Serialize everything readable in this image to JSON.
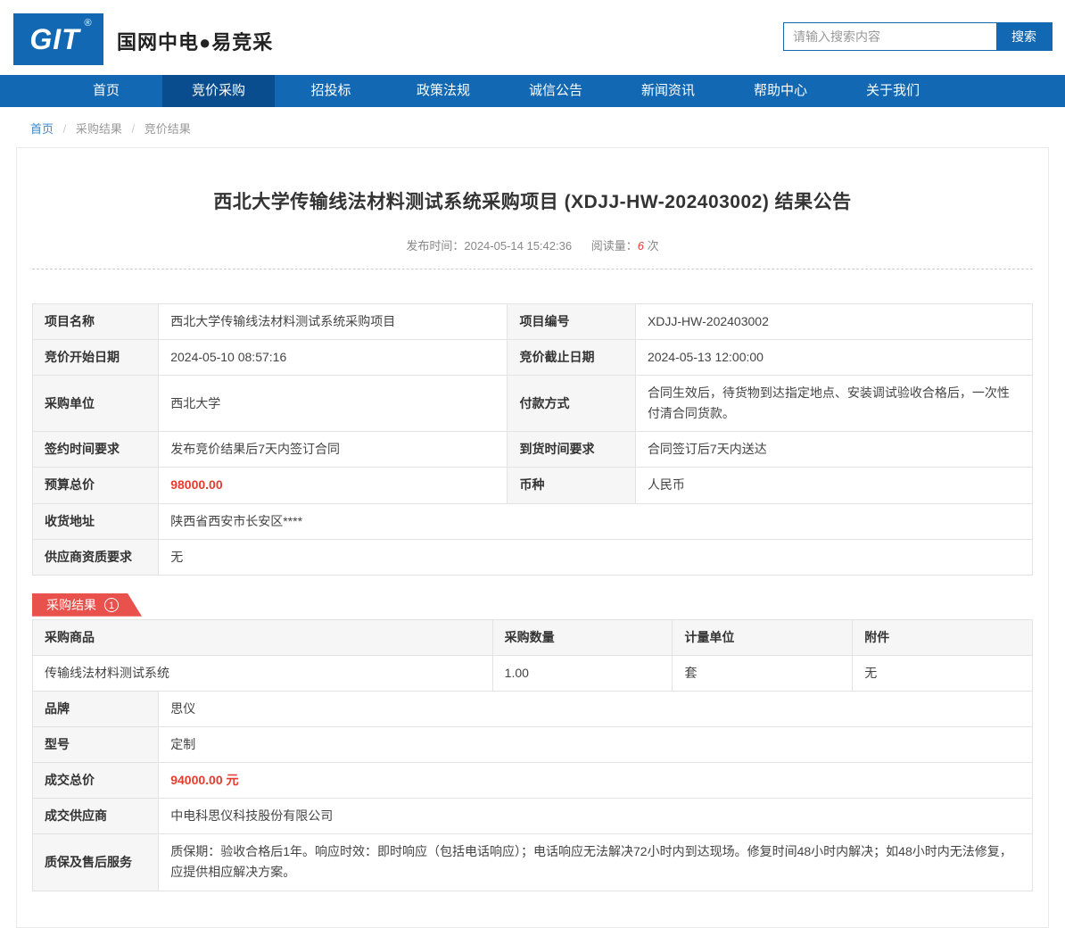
{
  "header": {
    "logo_text": "GIT",
    "logo_reg": "®",
    "brand": "国网中电●易竞采",
    "search": {
      "placeholder": "请输入搜索内容",
      "button_label": "搜索"
    }
  },
  "nav": {
    "items": [
      {
        "label": "首页"
      },
      {
        "label": "竞价采购"
      },
      {
        "label": "招投标"
      },
      {
        "label": "政策法规"
      },
      {
        "label": "诚信公告"
      },
      {
        "label": "新闻资讯"
      },
      {
        "label": "帮助中心"
      },
      {
        "label": "关于我们"
      }
    ],
    "active_index": 1
  },
  "breadcrumb": {
    "items": [
      "首页",
      "采购结果",
      "竞价结果"
    ],
    "separator": "/"
  },
  "article": {
    "title": "西北大学传输线法材料测试系统采购项目 (XDJJ-HW-202403002) 结果公告",
    "publish_label": "发布时间：",
    "publish_time": "2024-05-14 15:42:36",
    "views_label": "阅读量：",
    "views_count": "6",
    "views_unit": "次"
  },
  "info_table": {
    "rows": [
      {
        "cells": [
          {
            "label": "项目名称",
            "value": "西北大学传输线法材料测试系统采购项目"
          },
          {
            "label": "项目编号",
            "value": "XDJJ-HW-202403002"
          }
        ]
      },
      {
        "cells": [
          {
            "label": "竞价开始日期",
            "value": "2024-05-10 08:57:16"
          },
          {
            "label": "竞价截止日期",
            "value": "2024-05-13 12:00:00"
          }
        ]
      },
      {
        "cells": [
          {
            "label": "采购单位",
            "value": "西北大学"
          },
          {
            "label": "付款方式",
            "value": "合同生效后，待货物到达指定地点、安装调试验收合格后，一次性付清合同货款。"
          }
        ]
      },
      {
        "cells": [
          {
            "label": "签约时间要求",
            "value": "发布竞价结果后7天内签订合同"
          },
          {
            "label": "到货时间要求",
            "value": "合同签订后7天内送达"
          }
        ]
      },
      {
        "cells": [
          {
            "label": "预算总价",
            "value": "98000.00"
          },
          {
            "label": "币种",
            "value": "人民币"
          }
        ]
      },
      {
        "cells": [
          {
            "label": "收货地址",
            "value": "陕西省西安市长安区****"
          }
        ]
      },
      {
        "cells": [
          {
            "label": "供应商资质要求",
            "value": "无"
          }
        ]
      }
    ]
  },
  "result": {
    "badge_label": "采购结果",
    "badge_count": "1",
    "product_table": {
      "headers": [
        "采购商品",
        "采购数量",
        "计量单位",
        "附件"
      ],
      "rows": [
        [
          "传输线法材料测试系统",
          "1.00",
          "套",
          "无"
        ]
      ]
    },
    "detail_rows": [
      {
        "label": "品牌",
        "value": "思仪"
      },
      {
        "label": "型号",
        "value": "定制"
      },
      {
        "label": "成交总价",
        "value": "94000.00 元"
      },
      {
        "label": "成交供应商",
        "value": "中电科思仪科技股份有限公司"
      },
      {
        "label": "质保及售后服务",
        "value": "质保期：验收合格后1年。响应时效：即时响应（包括电话响应）；电话响应无法解决72小时内到达现场。修复时间48小时内解决；如48小时内无法修复，应提供相应解决方案。"
      }
    ]
  },
  "colors": {
    "primary_blue": "#1268b2",
    "active_nav_blue": "#0a4d8f",
    "badge_red": "#e8514c",
    "price_red": "#e63c2f"
  }
}
